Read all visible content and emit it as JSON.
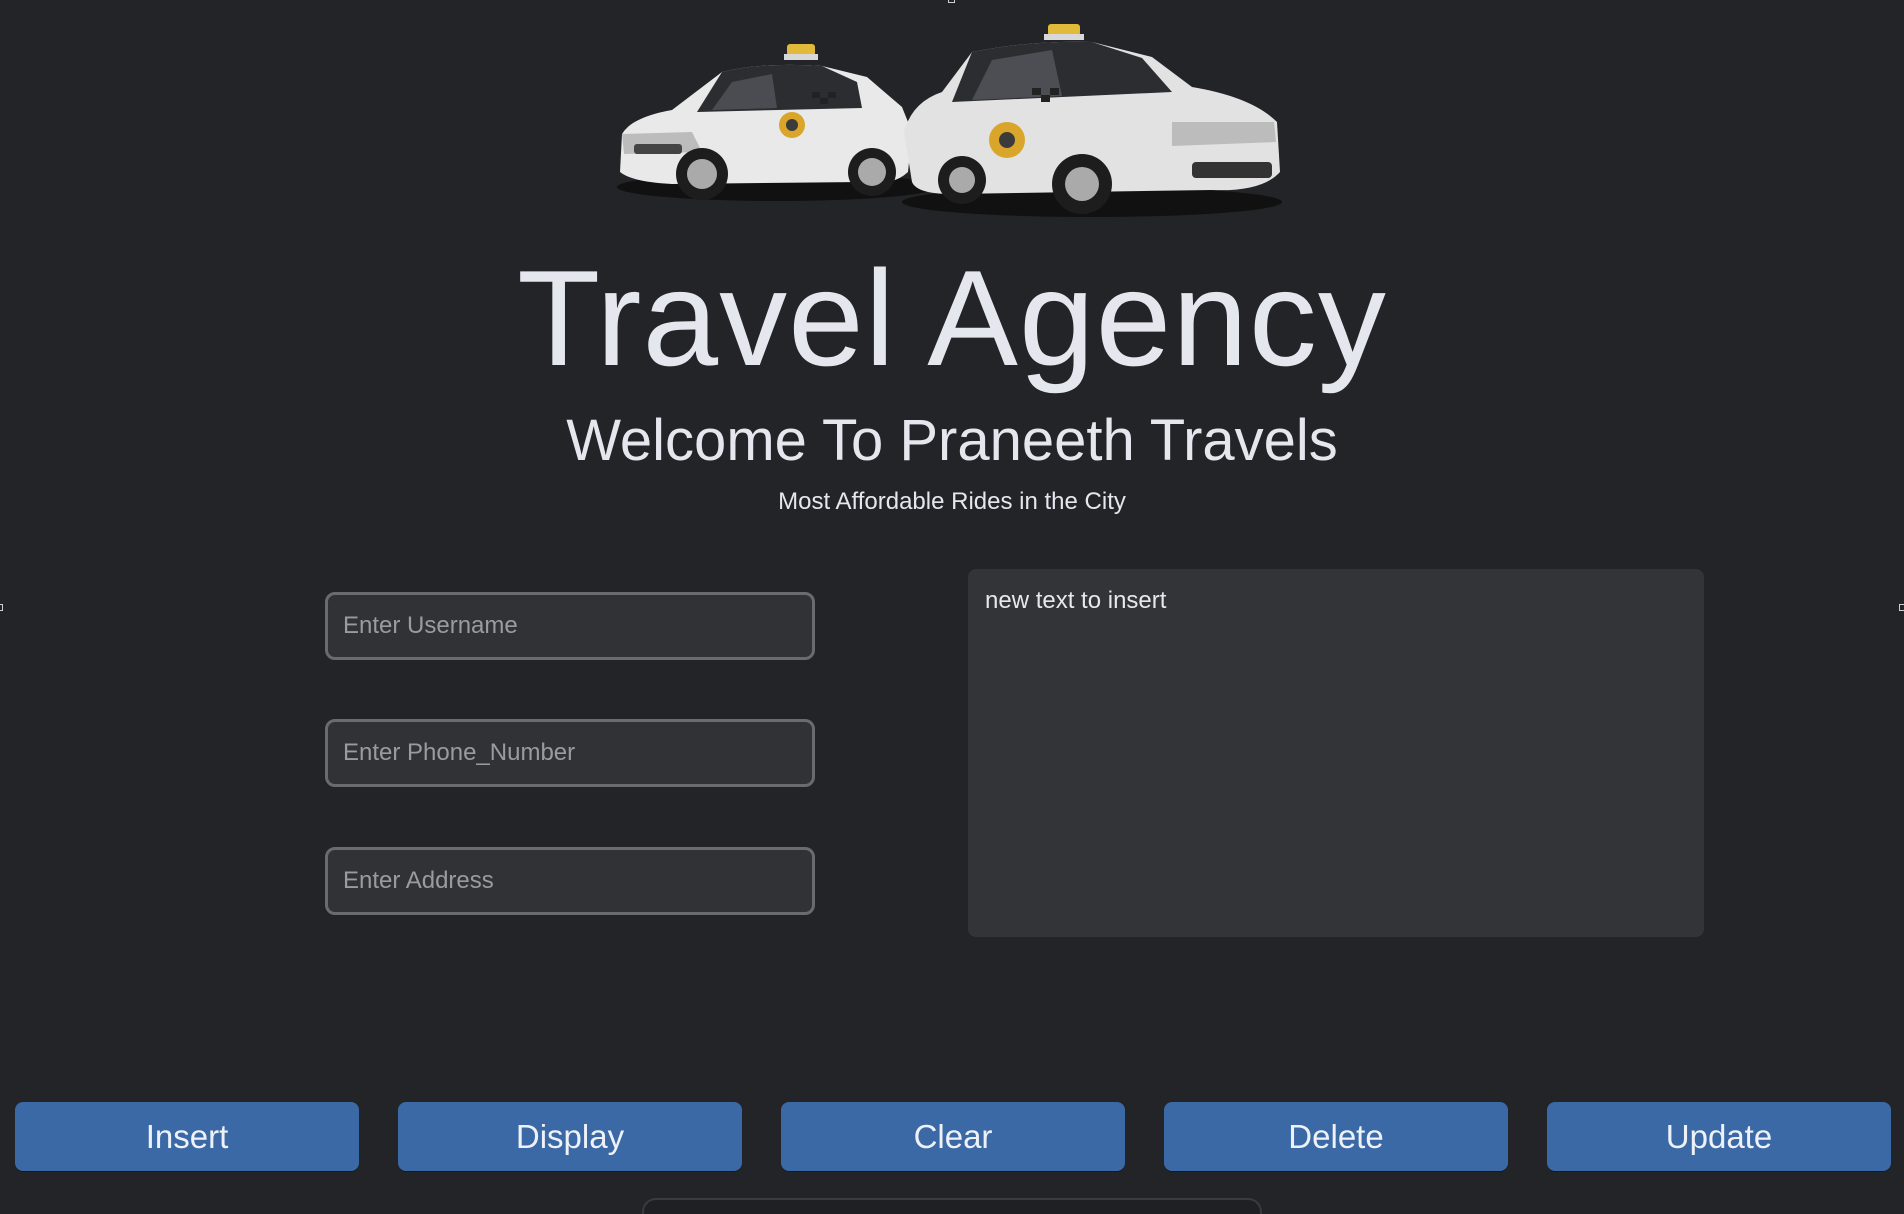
{
  "header": {
    "image_name": "taxi-cars-image",
    "title": "Travel Agency",
    "subtitle": "Welcome To Praneeth Travels",
    "tagline": "Most Affordable Rides in the City"
  },
  "form": {
    "username_placeholder": "Enter Username",
    "phone_placeholder": "Enter Phone_Number",
    "address_placeholder": "Enter Address",
    "notes_value": "new text to insert"
  },
  "buttons": {
    "insert": "Insert",
    "display": "Display",
    "clear": "Clear",
    "delete": "Delete",
    "update": "Update"
  },
  "colors": {
    "background": "#232427",
    "button": "#3a69a6",
    "field_border": "#6a6b6f"
  }
}
